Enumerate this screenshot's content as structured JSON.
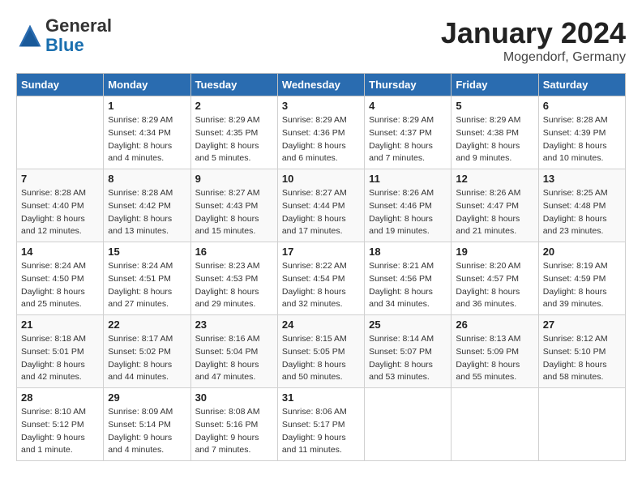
{
  "header": {
    "logo_general": "General",
    "logo_blue": "Blue",
    "month_title": "January 2024",
    "location": "Mogendorf, Germany"
  },
  "days_of_week": [
    "Sunday",
    "Monday",
    "Tuesday",
    "Wednesday",
    "Thursday",
    "Friday",
    "Saturday"
  ],
  "weeks": [
    [
      {
        "day": "",
        "sunrise": "",
        "sunset": "",
        "daylight": ""
      },
      {
        "day": "1",
        "sunrise": "Sunrise: 8:29 AM",
        "sunset": "Sunset: 4:34 PM",
        "daylight": "Daylight: 8 hours and 4 minutes."
      },
      {
        "day": "2",
        "sunrise": "Sunrise: 8:29 AM",
        "sunset": "Sunset: 4:35 PM",
        "daylight": "Daylight: 8 hours and 5 minutes."
      },
      {
        "day": "3",
        "sunrise": "Sunrise: 8:29 AM",
        "sunset": "Sunset: 4:36 PM",
        "daylight": "Daylight: 8 hours and 6 minutes."
      },
      {
        "day": "4",
        "sunrise": "Sunrise: 8:29 AM",
        "sunset": "Sunset: 4:37 PM",
        "daylight": "Daylight: 8 hours and 7 minutes."
      },
      {
        "day": "5",
        "sunrise": "Sunrise: 8:29 AM",
        "sunset": "Sunset: 4:38 PM",
        "daylight": "Daylight: 8 hours and 9 minutes."
      },
      {
        "day": "6",
        "sunrise": "Sunrise: 8:28 AM",
        "sunset": "Sunset: 4:39 PM",
        "daylight": "Daylight: 8 hours and 10 minutes."
      }
    ],
    [
      {
        "day": "7",
        "sunrise": "Sunrise: 8:28 AM",
        "sunset": "Sunset: 4:40 PM",
        "daylight": "Daylight: 8 hours and 12 minutes."
      },
      {
        "day": "8",
        "sunrise": "Sunrise: 8:28 AM",
        "sunset": "Sunset: 4:42 PM",
        "daylight": "Daylight: 8 hours and 13 minutes."
      },
      {
        "day": "9",
        "sunrise": "Sunrise: 8:27 AM",
        "sunset": "Sunset: 4:43 PM",
        "daylight": "Daylight: 8 hours and 15 minutes."
      },
      {
        "day": "10",
        "sunrise": "Sunrise: 8:27 AM",
        "sunset": "Sunset: 4:44 PM",
        "daylight": "Daylight: 8 hours and 17 minutes."
      },
      {
        "day": "11",
        "sunrise": "Sunrise: 8:26 AM",
        "sunset": "Sunset: 4:46 PM",
        "daylight": "Daylight: 8 hours and 19 minutes."
      },
      {
        "day": "12",
        "sunrise": "Sunrise: 8:26 AM",
        "sunset": "Sunset: 4:47 PM",
        "daylight": "Daylight: 8 hours and 21 minutes."
      },
      {
        "day": "13",
        "sunrise": "Sunrise: 8:25 AM",
        "sunset": "Sunset: 4:48 PM",
        "daylight": "Daylight: 8 hours and 23 minutes."
      }
    ],
    [
      {
        "day": "14",
        "sunrise": "Sunrise: 8:24 AM",
        "sunset": "Sunset: 4:50 PM",
        "daylight": "Daylight: 8 hours and 25 minutes."
      },
      {
        "day": "15",
        "sunrise": "Sunrise: 8:24 AM",
        "sunset": "Sunset: 4:51 PM",
        "daylight": "Daylight: 8 hours and 27 minutes."
      },
      {
        "day": "16",
        "sunrise": "Sunrise: 8:23 AM",
        "sunset": "Sunset: 4:53 PM",
        "daylight": "Daylight: 8 hours and 29 minutes."
      },
      {
        "day": "17",
        "sunrise": "Sunrise: 8:22 AM",
        "sunset": "Sunset: 4:54 PM",
        "daylight": "Daylight: 8 hours and 32 minutes."
      },
      {
        "day": "18",
        "sunrise": "Sunrise: 8:21 AM",
        "sunset": "Sunset: 4:56 PM",
        "daylight": "Daylight: 8 hours and 34 minutes."
      },
      {
        "day": "19",
        "sunrise": "Sunrise: 8:20 AM",
        "sunset": "Sunset: 4:57 PM",
        "daylight": "Daylight: 8 hours and 36 minutes."
      },
      {
        "day": "20",
        "sunrise": "Sunrise: 8:19 AM",
        "sunset": "Sunset: 4:59 PM",
        "daylight": "Daylight: 8 hours and 39 minutes."
      }
    ],
    [
      {
        "day": "21",
        "sunrise": "Sunrise: 8:18 AM",
        "sunset": "Sunset: 5:01 PM",
        "daylight": "Daylight: 8 hours and 42 minutes."
      },
      {
        "day": "22",
        "sunrise": "Sunrise: 8:17 AM",
        "sunset": "Sunset: 5:02 PM",
        "daylight": "Daylight: 8 hours and 44 minutes."
      },
      {
        "day": "23",
        "sunrise": "Sunrise: 8:16 AM",
        "sunset": "Sunset: 5:04 PM",
        "daylight": "Daylight: 8 hours and 47 minutes."
      },
      {
        "day": "24",
        "sunrise": "Sunrise: 8:15 AM",
        "sunset": "Sunset: 5:05 PM",
        "daylight": "Daylight: 8 hours and 50 minutes."
      },
      {
        "day": "25",
        "sunrise": "Sunrise: 8:14 AM",
        "sunset": "Sunset: 5:07 PM",
        "daylight": "Daylight: 8 hours and 53 minutes."
      },
      {
        "day": "26",
        "sunrise": "Sunrise: 8:13 AM",
        "sunset": "Sunset: 5:09 PM",
        "daylight": "Daylight: 8 hours and 55 minutes."
      },
      {
        "day": "27",
        "sunrise": "Sunrise: 8:12 AM",
        "sunset": "Sunset: 5:10 PM",
        "daylight": "Daylight: 8 hours and 58 minutes."
      }
    ],
    [
      {
        "day": "28",
        "sunrise": "Sunrise: 8:10 AM",
        "sunset": "Sunset: 5:12 PM",
        "daylight": "Daylight: 9 hours and 1 minute."
      },
      {
        "day": "29",
        "sunrise": "Sunrise: 8:09 AM",
        "sunset": "Sunset: 5:14 PM",
        "daylight": "Daylight: 9 hours and 4 minutes."
      },
      {
        "day": "30",
        "sunrise": "Sunrise: 8:08 AM",
        "sunset": "Sunset: 5:16 PM",
        "daylight": "Daylight: 9 hours and 7 minutes."
      },
      {
        "day": "31",
        "sunrise": "Sunrise: 8:06 AM",
        "sunset": "Sunset: 5:17 PM",
        "daylight": "Daylight: 9 hours and 11 minutes."
      },
      {
        "day": "",
        "sunrise": "",
        "sunset": "",
        "daylight": ""
      },
      {
        "day": "",
        "sunrise": "",
        "sunset": "",
        "daylight": ""
      },
      {
        "day": "",
        "sunrise": "",
        "sunset": "",
        "daylight": ""
      }
    ]
  ]
}
